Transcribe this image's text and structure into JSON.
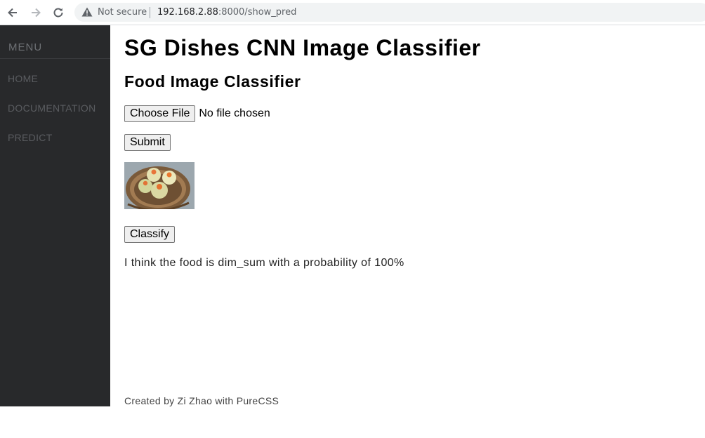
{
  "browser": {
    "security_label": "Not secure",
    "url_host": "192.168.2.88",
    "url_rest": ":8000/show_pred"
  },
  "sidebar": {
    "heading": "MENU",
    "items": [
      {
        "label": "HOME"
      },
      {
        "label": "DOCUMENTATION"
      },
      {
        "label": "PREDICT"
      }
    ]
  },
  "main": {
    "title": "SG Dishes CNN Image Classifier",
    "subtitle": "Food Image Classifier",
    "file_button": "Choose File",
    "file_status": "No file chosen",
    "submit_label": "Submit",
    "classify_label": "Classify",
    "result_text": "I think the food is dim_sum with a probability of 100%"
  },
  "footer": {
    "text": "Created by Zi Zhao with PureCSS"
  },
  "colors": {
    "sidebar_bg": "#28292b",
    "sidebar_text": "#5a5c60"
  }
}
